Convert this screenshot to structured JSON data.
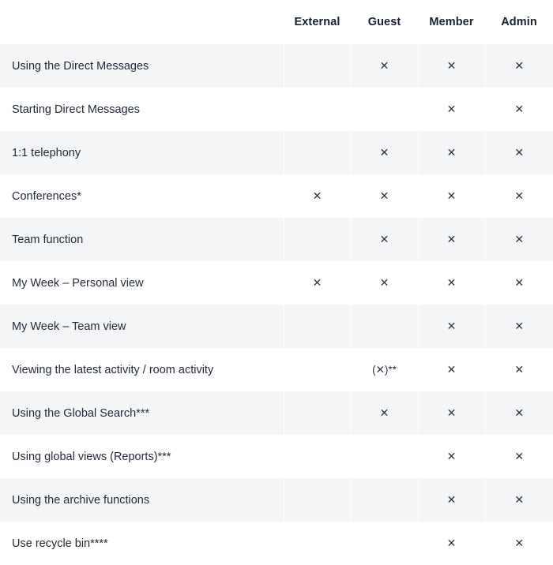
{
  "table": {
    "feature_column_header": "",
    "role_columns": [
      "External",
      "Guest",
      "Member",
      "Admin"
    ],
    "mark_symbol": "✕",
    "conditional_symbol": "(✕)**",
    "colors": {
      "page_background": "#ffffff",
      "shaded_row": "#f4f5f7",
      "header_text": "#16202f",
      "body_text": "#1f2937",
      "mark": "#2b3445"
    },
    "rows": [
      {
        "feature": "Using the Direct Messages",
        "External": "",
        "Guest": "✕",
        "Member": "✕",
        "Admin": "✕"
      },
      {
        "feature": "Starting Direct Messages",
        "External": "",
        "Guest": "",
        "Member": "✕",
        "Admin": "✕"
      },
      {
        "feature": "1:1 telephony",
        "External": "",
        "Guest": "✕",
        "Member": "✕",
        "Admin": "✕"
      },
      {
        "feature": "Conferences*",
        "External": "✕",
        "Guest": "✕",
        "Member": "✕",
        "Admin": "✕"
      },
      {
        "feature": "Team function",
        "External": "",
        "Guest": "✕",
        "Member": "✕",
        "Admin": "✕"
      },
      {
        "feature": "My Week – Personal view",
        "External": "✕",
        "Guest": "✕",
        "Member": "✕",
        "Admin": "✕"
      },
      {
        "feature": "My Week – Team view",
        "External": "",
        "Guest": "",
        "Member": "✕",
        "Admin": "✕"
      },
      {
        "feature": "Viewing the latest activity / room activity",
        "External": "",
        "Guest": "(✕)**",
        "Member": "✕",
        "Admin": "✕"
      },
      {
        "feature": "Using the Global Search***",
        "External": "",
        "Guest": "✕",
        "Member": "✕",
        "Admin": "✕"
      },
      {
        "feature": "Using global views (Reports)***",
        "External": "",
        "Guest": "",
        "Member": "✕",
        "Admin": "✕"
      },
      {
        "feature": "Using the archive functions",
        "External": "",
        "Guest": "",
        "Member": "✕",
        "Admin": "✕"
      },
      {
        "feature": "Use recycle bin****",
        "External": "",
        "Guest": "",
        "Member": "✕",
        "Admin": "✕"
      }
    ]
  }
}
